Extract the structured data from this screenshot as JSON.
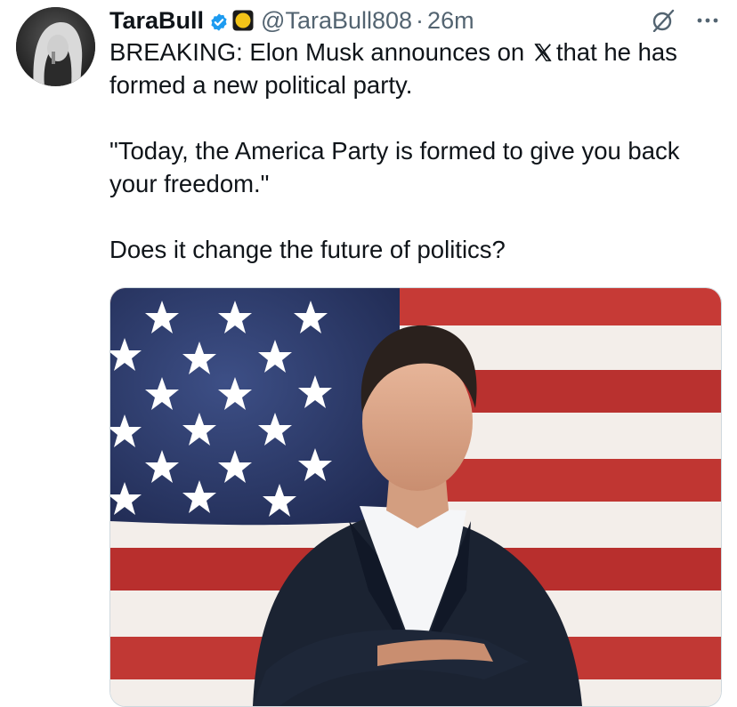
{
  "author": {
    "name": "TaraBull",
    "handle": "@TaraBull808",
    "separator": "·",
    "time": "26m"
  },
  "icons": {
    "verified": "verified-badge-icon",
    "affiliate": "gold-circle-badge-icon",
    "grok": "grok-icon",
    "more": "more-icon",
    "x_logo": "x-logo-icon"
  },
  "colors": {
    "verified_blue": "#1d9bf0",
    "secondary_text": "#536471",
    "primary_text": "#0f1419"
  },
  "tweet": {
    "line1_before": "BREAKING: Elon Musk announces on",
    "line1_after": "that he has formed a new political party.",
    "quote": "\"Today, the America Party is formed to give you back your freedom.\"",
    "question": "Does it change the future of politics?"
  },
  "media": {
    "description_icon": "photo"
  }
}
